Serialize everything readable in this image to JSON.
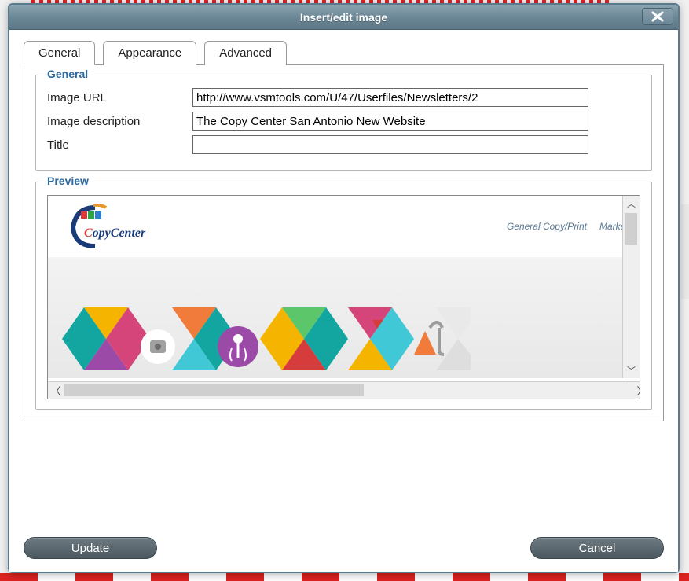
{
  "dialog": {
    "title": "Insert/edit image"
  },
  "tabs": [
    {
      "label": "General",
      "active": true
    },
    {
      "label": "Appearance",
      "active": false
    },
    {
      "label": "Advanced",
      "active": false
    }
  ],
  "general": {
    "legend": "General",
    "image_url_label": "Image URL",
    "image_url_value": "http://www.vsmtools.com/U/47/Userfiles/Newsletters/2",
    "image_description_label": "Image description",
    "image_description_value": "The Copy Center San Antonio New Website",
    "title_label": "Title",
    "title_value": ""
  },
  "preview": {
    "legend": "Preview",
    "logo_text": "CopyCenter",
    "nav": [
      "General Copy/Print",
      "Marketin"
    ]
  },
  "buttons": {
    "update": "Update",
    "cancel": "Cancel"
  }
}
